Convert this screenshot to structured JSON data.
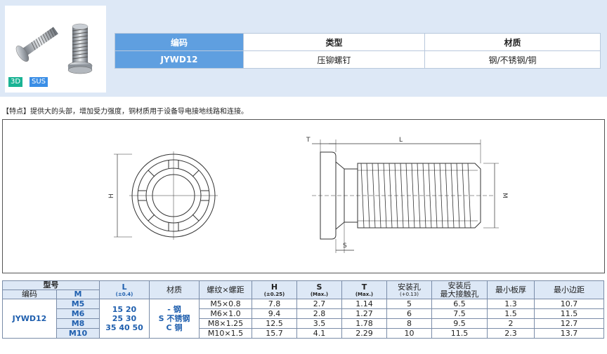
{
  "badges": {
    "d3": "3D",
    "sus": "SUS"
  },
  "code_table": {
    "headers": [
      "编码",
      "类型",
      "材质"
    ],
    "values": [
      "JYWD12",
      "压铆螺钉",
      "钢/不锈钢/铜"
    ]
  },
  "feature_text": "【特点】提供大的头部，增加受力强度，铜材质用于设备导电接地线路和连接。",
  "drawing_labels": {
    "H": "H",
    "T": "T",
    "L": "L",
    "M": "M",
    "S": "S"
  },
  "spec": {
    "h_model": "型号",
    "h_code": "编码",
    "h_M": "M",
    "h_L": "L",
    "h_L_tol": "(±0.4)",
    "h_material": "材质",
    "h_thread": "螺纹×螺距",
    "h_H": "H",
    "h_H_tol": "(±0.25)",
    "h_S": "S",
    "h_S_tol": "(Max.)",
    "h_T": "T",
    "h_T_tol": "(Max.)",
    "h_hole": "安装孔",
    "h_hole_tol": "(+0.13)",
    "h_after1": "安装后",
    "h_after2": "最大接触孔",
    "h_plate": "最小板厚",
    "h_edge": "最小边距",
    "code": "JYWD12",
    "L_values": [
      "15 20",
      "25 30",
      "35 40 50"
    ],
    "materials": [
      "- 钢",
      "S 不锈钢",
      "C 铜"
    ],
    "rows": [
      {
        "M": "M5",
        "thread": "M5×0.8",
        "H": "7.8",
        "S": "2.7",
        "T": "1.14",
        "hole": "5",
        "after": "6.5",
        "plate": "1.3",
        "edge": "10.7"
      },
      {
        "M": "M6",
        "thread": "M6×1.0",
        "H": "9.4",
        "S": "2.8",
        "T": "1.27",
        "hole": "6",
        "after": "7.5",
        "plate": "1.5",
        "edge": "11.5"
      },
      {
        "M": "M8",
        "thread": "M8×1.25",
        "H": "12.5",
        "S": "3.5",
        "T": "1.78",
        "hole": "8",
        "after": "9.5",
        "plate": "2",
        "edge": "12.7"
      },
      {
        "M": "M10",
        "thread": "M10×1.5",
        "H": "15.7",
        "S": "4.1",
        "T": "2.29",
        "hole": "10",
        "after": "11.5",
        "plate": "2.3",
        "edge": "13.7"
      }
    ]
  }
}
